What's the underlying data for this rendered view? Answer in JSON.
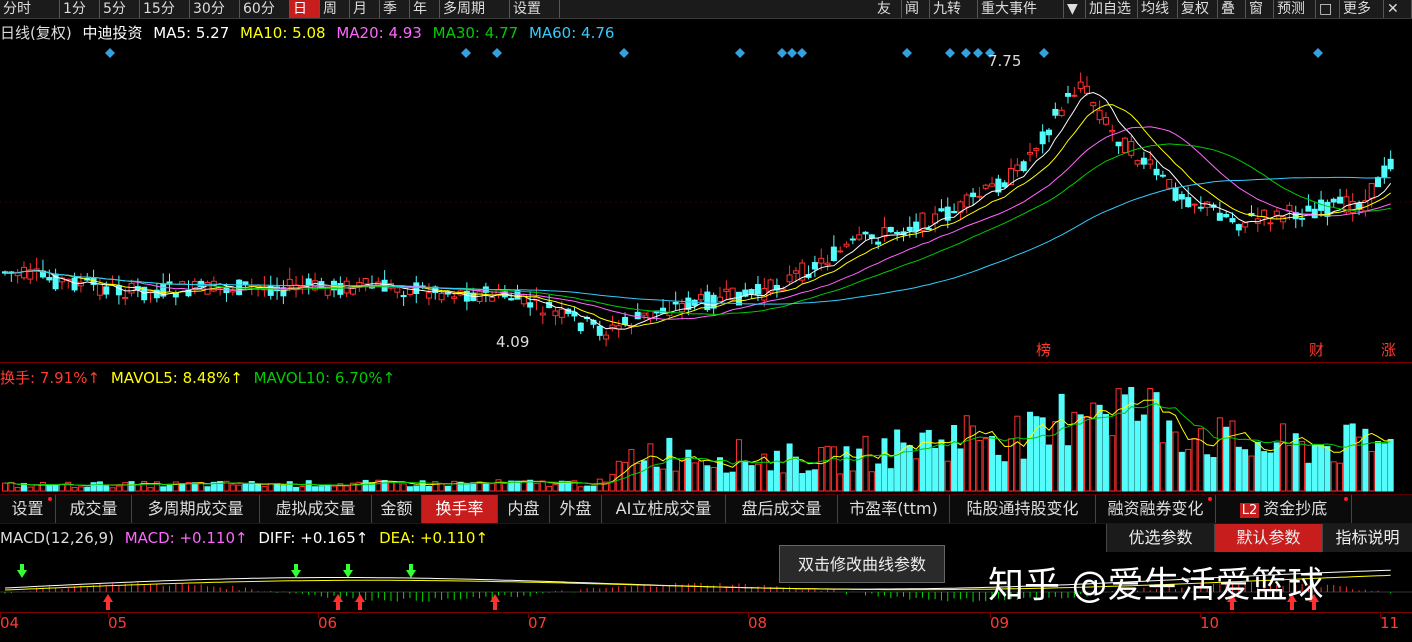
{
  "toolbar": {
    "left": [
      "分时",
      "1分",
      "5分",
      "15分",
      "30分",
      "60分",
      "日",
      "周",
      "月",
      "季",
      "年",
      "多周期",
      "设置"
    ],
    "active": "日",
    "right": [
      "友",
      "闻",
      "九转",
      "重大事件",
      "▼",
      "加自选",
      "均线",
      "复权",
      "叠",
      "窗",
      "预测",
      "□",
      "更多",
      "✕"
    ]
  },
  "price_legend": {
    "period": "日线(复权)",
    "stock": "中迪投资",
    "ma5": "MA5: 5.27",
    "ma10": "MA10: 5.08",
    "ma20": "MA20: 4.93",
    "ma30": "MA30: 4.77",
    "ma60": "MA60: 4.76",
    "arrow": "↑",
    "colors": {
      "ma5": "#ffffff",
      "ma10": "#ffff00",
      "ma20": "#ff66ff",
      "ma30": "#00cc00",
      "ma60": "#33ccff"
    }
  },
  "price_high": "7.75",
  "price_low": "4.09",
  "badges": {
    "bang": "榜",
    "cai": "财",
    "zhang": "涨"
  },
  "vol_legend": {
    "turnover": "换手: 7.91%↑",
    "mavol5": "MAVOL5: 8.48%↑",
    "mavol10": "MAVOL10: 6.70%↑"
  },
  "indicator_tabs": [
    {
      "label": "设置",
      "dot": true
    },
    {
      "label": "成交量",
      "dot": false
    },
    {
      "label": "多周期成交量",
      "dot": false
    },
    {
      "label": "虚拟成交量",
      "dot": false
    },
    {
      "label": "金额",
      "dot": false
    },
    {
      "label": "换手率",
      "dot": false,
      "active": true
    },
    {
      "label": "内盘",
      "dot": false
    },
    {
      "label": "外盘",
      "dot": false
    },
    {
      "label": "AI立桩成交量",
      "dot": false
    },
    {
      "label": "盘后成交量",
      "dot": false
    },
    {
      "label": "市盈率(ttm)",
      "dot": false
    },
    {
      "label": "陆股通持股变化",
      "dot": false
    },
    {
      "label": "融资融券变化",
      "dot": true
    },
    {
      "label": "资金抄底",
      "dot": true,
      "prefix": "L2"
    }
  ],
  "macd_legend": {
    "name": "MACD(12,26,9)",
    "macd": "MACD: +0.110↑",
    "diff": "DIFF: +0.165↑",
    "dea": "DEA: +0.110↑"
  },
  "macd_buttons": {
    "optimize": "优选参数",
    "default": "默认参数",
    "help": "指标说明"
  },
  "tooltip": "双击修改曲线参数",
  "x_axis": [
    "04",
    "05",
    "06",
    "07",
    "08",
    "09",
    "10",
    "11"
  ],
  "watermark": "知乎 @爱生活爱篮球"
}
